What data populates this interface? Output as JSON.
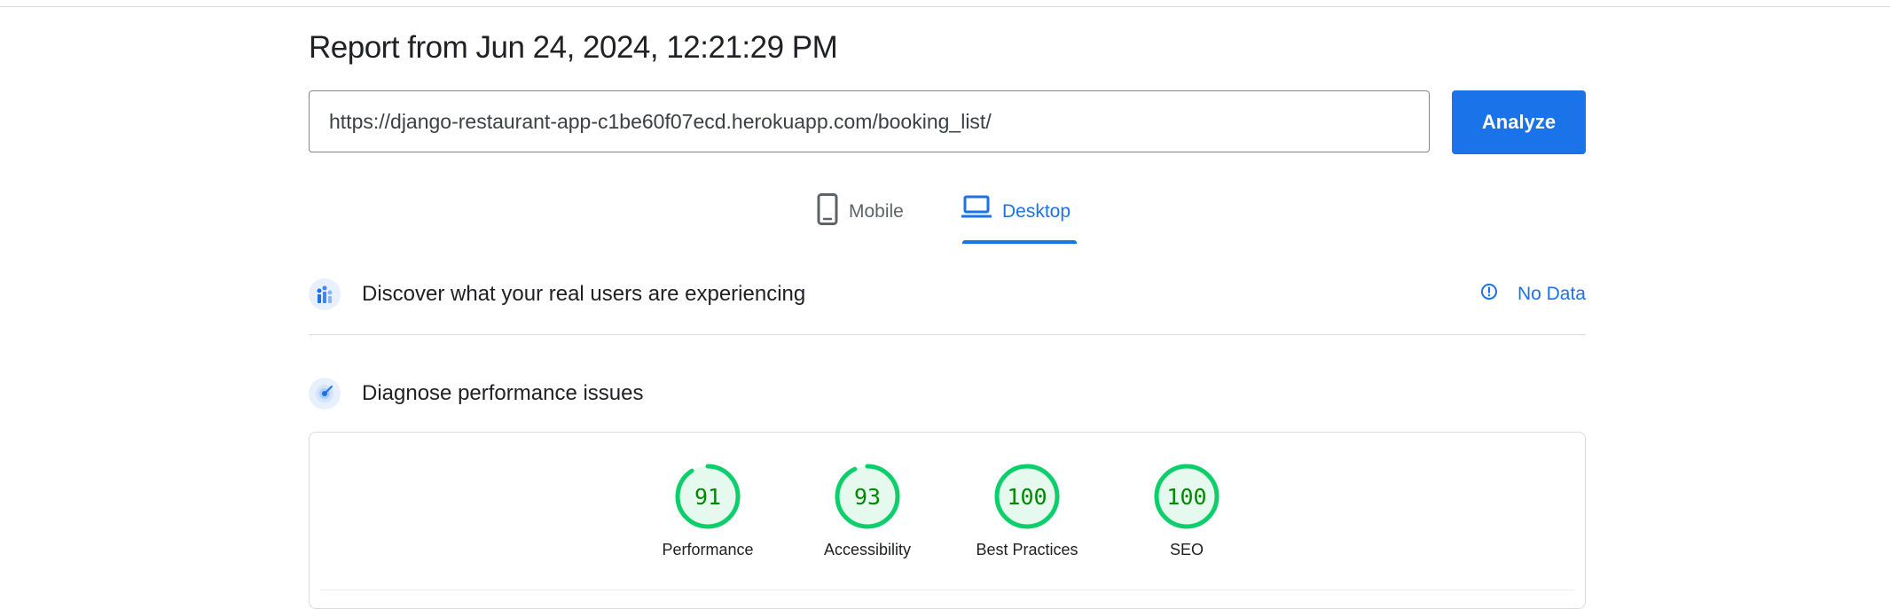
{
  "report": {
    "title": "Report from Jun 24, 2024, 12:21:29 PM"
  },
  "url_input": {
    "value": "https://django-restaurant-app-c1be60f07ecd.herokuapp.com/booking_list/"
  },
  "analyze_button": {
    "label": "Analyze"
  },
  "device_tabs": {
    "mobile": {
      "label": "Mobile",
      "icon": "phone-icon",
      "selected": false
    },
    "desktop": {
      "label": "Desktop",
      "icon": "laptop-icon",
      "selected": true
    }
  },
  "real_users": {
    "title": "Discover what your real users are experiencing",
    "icon": "users-chart-icon",
    "status_label": "No Data",
    "status_icon": "info-icon"
  },
  "diagnose": {
    "title": "Diagnose performance issues",
    "icon": "gauge-icon"
  },
  "scores": [
    {
      "label": "Performance",
      "score": 91
    },
    {
      "label": "Accessibility",
      "score": 93
    },
    {
      "label": "Best Practices",
      "score": 100
    },
    {
      "label": "SEO",
      "score": 100
    }
  ],
  "colors": {
    "accent": "#1a73e8",
    "pass_ring": "#0cce6b",
    "pass_fill": "#e6f9ee",
    "pass_text": "#008800",
    "divider": "#dadce0"
  }
}
